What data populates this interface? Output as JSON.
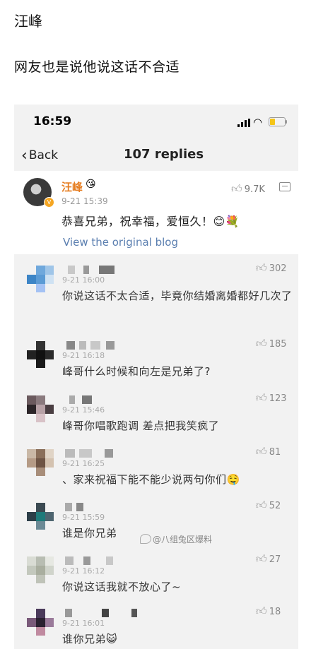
{
  "post": {
    "title": "汪峰",
    "text": "网友也是说他说这话不合适"
  },
  "status_bar": {
    "time": "16:59"
  },
  "nav": {
    "back_label": "Back",
    "title": "107 replies"
  },
  "main_comment": {
    "author": "汪峰",
    "time": "9-21 15:39",
    "likes": "9.7K",
    "text": "恭喜兄弟，祝幸福，爱恒久！😊💐",
    "link": "View the original blog"
  },
  "comments": [
    {
      "time": "9-21 16:00",
      "likes": "302",
      "text": "你说这话不太合适，毕竟你结婚离婚都好几次了"
    },
    {
      "time": "9-21 16:18",
      "likes": "185",
      "text": "峰哥什么时候和向左是兄弟了?"
    },
    {
      "time": "9-21 15:46",
      "likes": "123",
      "text": "峰哥你唱歌跑调 差点把我笑疯了"
    },
    {
      "time": "9-21 16:25",
      "likes": "81",
      "text": "、家来祝福下能不能少说两句你们🤤"
    },
    {
      "time": "9-21 15:59",
      "likes": "52",
      "text": "谁是你兄弟"
    },
    {
      "time": "9-21 16:12",
      "likes": "27",
      "text": "你说这话我就不放心了~"
    },
    {
      "time": "9-21 16:01",
      "likes": "18",
      "text": "谁你兄弟😺"
    }
  ],
  "watermark": "@八组兔区爆料",
  "colors": {
    "name_orange": "#e67e22",
    "link_blue": "#5b7fb0",
    "screenshot_bg": "#f2f2f2"
  }
}
